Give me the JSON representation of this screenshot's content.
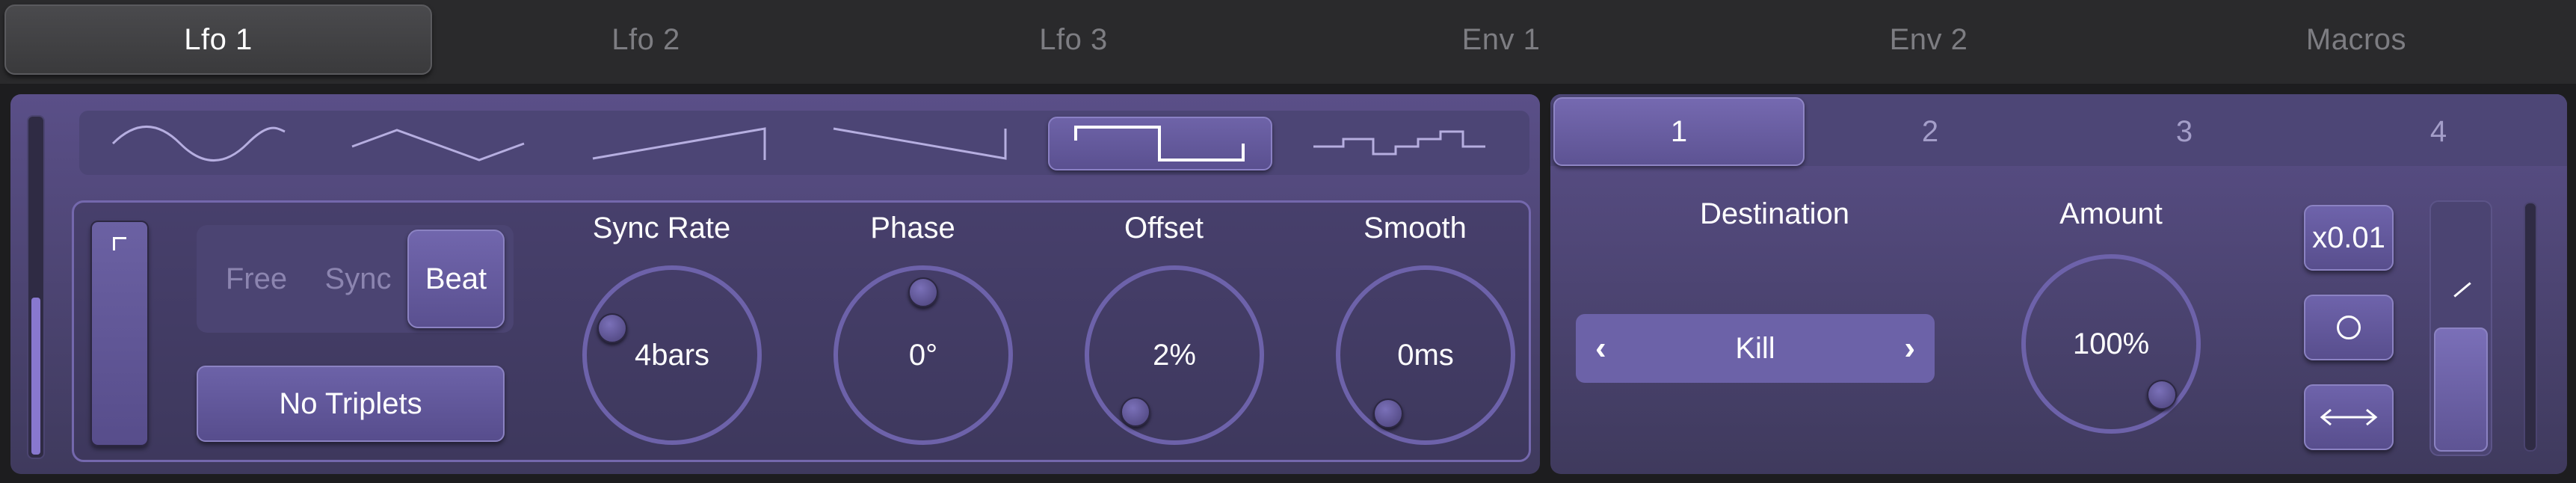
{
  "tabs": [
    {
      "label": "Lfo 1",
      "active": true
    },
    {
      "label": "Lfo 2",
      "active": false
    },
    {
      "label": "Lfo 3",
      "active": false
    },
    {
      "label": "Env 1",
      "active": false
    },
    {
      "label": "Env 2",
      "active": false
    },
    {
      "label": "Macros",
      "active": false
    }
  ],
  "waveforms": [
    {
      "icon": "sine-wave-icon",
      "active": false
    },
    {
      "icon": "triangle-wave-icon",
      "active": false
    },
    {
      "icon": "saw-up-wave-icon",
      "active": false
    },
    {
      "icon": "saw-down-wave-icon",
      "active": false
    },
    {
      "icon": "square-wave-icon",
      "active": true
    },
    {
      "icon": "random-step-wave-icon",
      "active": false
    }
  ],
  "side_meter_level": 0.46,
  "mode": {
    "options": [
      "Free",
      "Sync",
      "Beat"
    ],
    "selected": "Beat"
  },
  "triplet_button": "No Triplets",
  "knobs": {
    "sync_rate": {
      "title": "Sync Rate",
      "value": "4bars"
    },
    "phase": {
      "title": "Phase",
      "value": "0°"
    },
    "offset": {
      "title": "Offset",
      "value": "2%"
    },
    "smooth": {
      "title": "Smooth",
      "value": "0ms"
    }
  },
  "slots": [
    {
      "label": "1",
      "active": true
    },
    {
      "label": "2",
      "active": false
    },
    {
      "label": "3",
      "active": false
    },
    {
      "label": "4",
      "active": false
    }
  ],
  "destination": {
    "label": "Destination",
    "value": "Kill",
    "prev_icon": "chevron-left-icon",
    "next_icon": "chevron-right-icon"
  },
  "amount": {
    "label": "Amount",
    "value": "100%"
  },
  "side_buttons": {
    "multiplier": "x0.01",
    "circle_icon": "circle-icon",
    "bipolar_icon": "double-arrow-icon"
  },
  "colors": {
    "panel": "#5a4f88",
    "accent": "#8878cf",
    "tab_bg": "#2a2a2c"
  }
}
